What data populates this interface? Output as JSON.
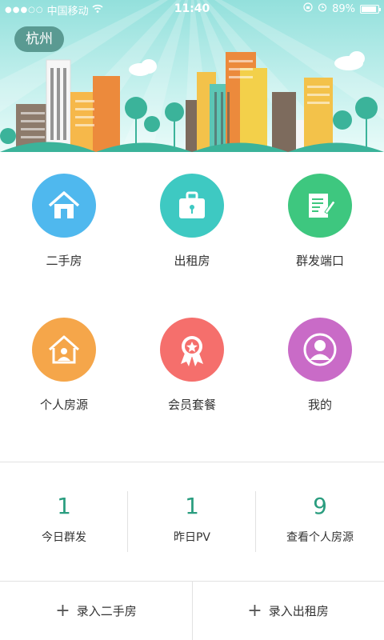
{
  "status_bar": {
    "carrier": "中国移动",
    "time": "11:40",
    "battery": "89%",
    "battery_level": 0.89
  },
  "header": {
    "city": "杭州"
  },
  "grid": [
    {
      "label": "二手房",
      "icon": "house-icon",
      "color": "#4fb8ee"
    },
    {
      "label": "出租房",
      "icon": "suitcase-lock-icon",
      "color": "#3ec9c2"
    },
    {
      "label": "群发端口",
      "icon": "document-edit-icon",
      "color": "#3ec77f"
    },
    {
      "label": "个人房源",
      "icon": "house-person-icon",
      "color": "#f5a64a"
    },
    {
      "label": "会员套餐",
      "icon": "ribbon-badge-icon",
      "color": "#f56f6c"
    },
    {
      "label": "我的",
      "icon": "user-profile-icon",
      "color": "#c96bc7"
    }
  ],
  "stats": [
    {
      "value": "1",
      "label": "今日群发"
    },
    {
      "value": "1",
      "label": "昨日PV"
    },
    {
      "value": "9",
      "label": "查看个人房源"
    }
  ],
  "actions": {
    "add_secondhand": "录入二手房",
    "add_rental": "录入出租房"
  },
  "colors": {
    "accent": "#2a9d7f",
    "city_pill": "#5a9a92"
  }
}
